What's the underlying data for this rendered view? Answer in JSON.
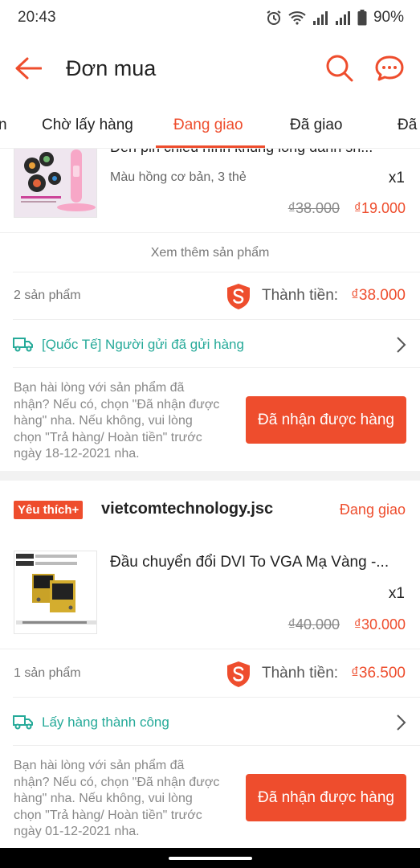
{
  "status_bar": {
    "time": "20:43",
    "battery": "90%",
    "icons": [
      "alarm-icon",
      "wifi-icon",
      "signal-icon",
      "signal-icon",
      "battery-icon"
    ]
  },
  "header": {
    "title": "Đơn mua",
    "icons": [
      "back-arrow-icon",
      "search-icon",
      "chat-icon"
    ],
    "accent_color": "#ee4d2d"
  },
  "tabs": [
    {
      "label": "n"
    },
    {
      "label": "Chờ lấy hàng"
    },
    {
      "label": "Đang giao",
      "active": true
    },
    {
      "label": "Đã giao"
    },
    {
      "label": "Đã"
    }
  ],
  "orders": [
    {
      "product": {
        "name": "Đèn pin chiếu hình khủng long đánh sh...",
        "variant": "Màu hồng cơ bản, 3 thẻ",
        "qty": "x1",
        "original_price": "₫38.000",
        "price": "₫19.000"
      },
      "more_products": "Xem thêm sản phẩm",
      "count": "2 sản phẩm",
      "total_label": "Thành tiền:",
      "total_value": "₫38.000",
      "shipping_status": "[Quốc Tế] Người gửi đã gửi hàng",
      "note": [
        "Bạn hài lòng với sản phẩm đã",
        "nhận? Nếu có, chọn \"Đã nhận được",
        "hàng\" nha. Nếu không, vui lòng",
        "chọn \"Trả hàng/ Hoàn tiền\" trước",
        "ngày 18-12-2021 nha."
      ],
      "button": "Đã nhận được hàng"
    },
    {
      "badge": "Yêu thích+",
      "shop": "vietcomtechnology.jsc",
      "status": "Đang giao",
      "product": {
        "name": "Đầu chuyển đổi DVI To VGA Mạ Vàng -...",
        "qty": "x1",
        "original_price": "₫40.000",
        "price": "₫30.000"
      },
      "count": "1 sản phẩm",
      "total_label": "Thành tiền:",
      "total_value": "₫36.500",
      "shipping_status": "Lấy hàng thành công",
      "note": [
        "Bạn hài lòng với sản phẩm đã",
        "nhận? Nếu có, chọn \"Đã nhận được",
        "hàng\" nha. Nếu không, vui lòng",
        "chọn \"Trả hàng/ Hoàn tiền\" trước",
        "ngày 01-12-2021 nha."
      ],
      "button": "Đã nhận được hàng"
    }
  ]
}
